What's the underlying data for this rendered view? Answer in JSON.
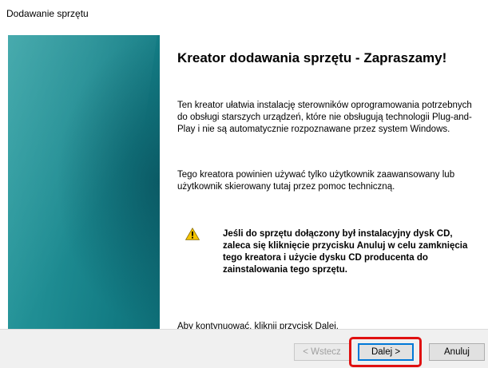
{
  "window": {
    "title": "Dodawanie sprzętu"
  },
  "wizard": {
    "heading": "Kreator dodawania sprzętu - Zapraszamy!",
    "paragraph1": "Ten kreator ułatwia instalację sterowników oprogramowania potrzebnych do obsługi starszych urządzeń, które nie obsługują technologii Plug-and-Play i nie są automatycznie rozpoznawane przez system Windows.",
    "paragraph2": "Tego kreatora powinien używać tylko użytkownik zaawansowany lub użytkownik skierowany tutaj przez pomoc techniczną.",
    "warning": "Jeśli do sprzętu dołączony był instalacyjny dysk CD, zaleca się kliknięcie przycisku Anuluj w celu zamknięcia tego kreatora i użycie dysku CD producenta do zainstalowania tego sprzętu.",
    "continue_text": "Aby kontynuować, kliknij przycisk Dalej."
  },
  "buttons": {
    "back": "< Wstecz",
    "next": "Dalej >",
    "cancel": "Anuluj"
  },
  "icons": {
    "warning": "warning-triangle-icon"
  },
  "colors": {
    "banner": "#1a8a90",
    "highlight": "#e01010",
    "default_button_border": "#0078d7"
  }
}
